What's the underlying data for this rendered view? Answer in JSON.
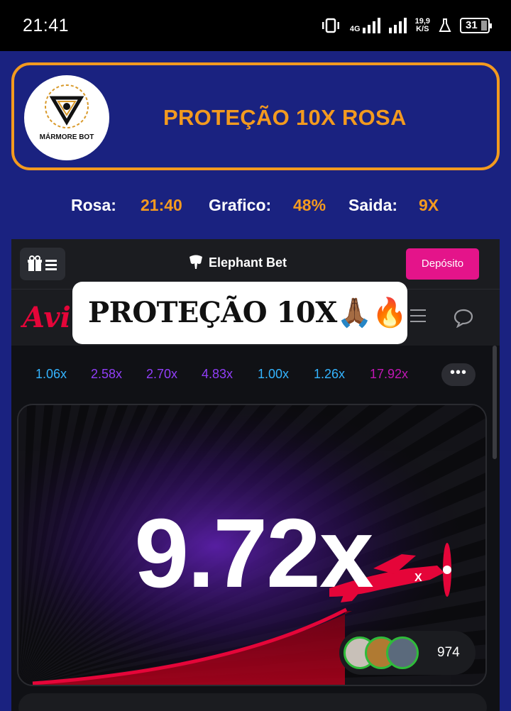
{
  "status": {
    "time": "21:41",
    "net_top": "4G",
    "speed_value": "19,9",
    "speed_unit": "K/S",
    "battery": "31"
  },
  "banner": {
    "logo_name": "MÁRMORE BOT",
    "title": "PROTEÇÃO 10X ROSA",
    "accent": "#f39a1f"
  },
  "info": {
    "rosa_label": "Rosa:",
    "rosa_value": "21:40",
    "grafico_label": "Grafico:",
    "grafico_value": "48%",
    "saida_label": "Saida:",
    "saida_value": "9X"
  },
  "app": {
    "brand": "Elephant Bet",
    "deposit_label": "Depósito",
    "game_logo": "Avi",
    "overlay_text": "PROTEÇÃO 10X🙏🏾🔥",
    "history": [
      {
        "value": "1.06x",
        "color": "#34b4ff"
      },
      {
        "value": "2.58x",
        "color": "#913ef8"
      },
      {
        "value": "2.70x",
        "color": "#913ef8"
      },
      {
        "value": "4.83x",
        "color": "#913ef8"
      },
      {
        "value": "1.00x",
        "color": "#34b4ff"
      },
      {
        "value": "1.26x",
        "color": "#34b4ff"
      },
      {
        "value": "17.92x",
        "color": "#c017b4"
      }
    ],
    "more_label": "•••",
    "multiplier": "9.72x",
    "players_count": "974",
    "accent_red": "#e50539"
  }
}
